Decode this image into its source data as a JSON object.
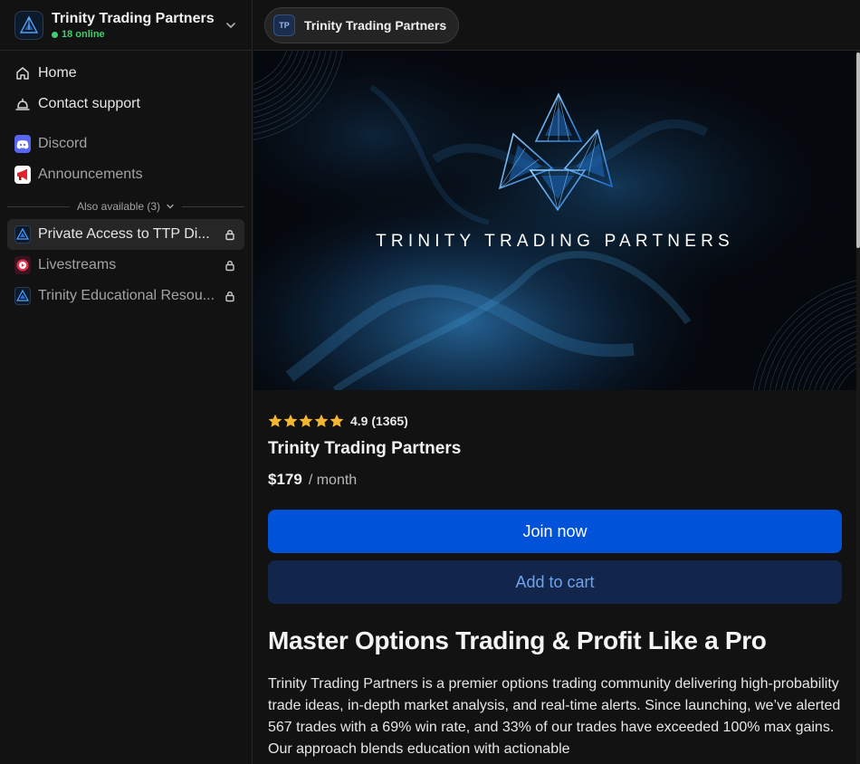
{
  "sidebar": {
    "title": "Trinity Trading Partners",
    "online": "18 online",
    "nav": [
      {
        "label": "Home",
        "icon": "home-icon"
      },
      {
        "label": "Contact support",
        "icon": "bell-icon"
      }
    ],
    "apps": [
      {
        "label": "Discord",
        "icon": "discord-icon"
      },
      {
        "label": "Announcements",
        "icon": "megaphone-icon"
      }
    ],
    "also_available_label": "Also available (3)",
    "locked_items": [
      {
        "label": "Private Access to TTP Di...",
        "icon": "ttp-logo-icon"
      },
      {
        "label": "Livestreams",
        "icon": "livestream-icon"
      },
      {
        "label": "Trinity Educational Resou...",
        "icon": "ttp-logo-icon"
      }
    ]
  },
  "topbar": {
    "pill_initials": "TP",
    "pill_label": "Trinity Trading Partners"
  },
  "banner": {
    "text": "TRINITY TRADING PARTNERS"
  },
  "product": {
    "rating": "4.9 (1365)",
    "stars": 5,
    "name": "Trinity Trading Partners",
    "price": "$179",
    "period": "/ month",
    "join_label": "Join now",
    "cart_label": "Add to cart",
    "headline": "Master Options Trading & Profit Like a Pro",
    "description": "Trinity Trading Partners is a premier options trading community delivering high-probability trade ideas, in-depth market analysis, and real-time alerts. Since launching, we’ve alerted 567 trades with a 69% win rate, and 33% of our trades have exceeded 100% max gains. Our approach blends education with actionable"
  },
  "colors": {
    "primary_button": "#0052d9",
    "secondary_button": "#11264a",
    "online": "#3ecf6e",
    "star": "#f5b731"
  }
}
